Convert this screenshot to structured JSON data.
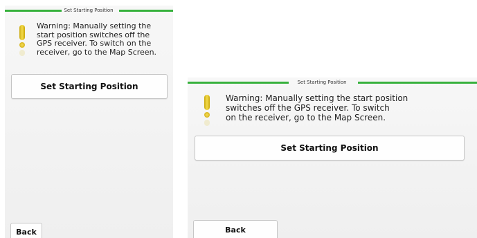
{
  "screens": [
    {
      "title": "Set Starting Position",
      "warning": "Warning: Manually setting the\nstart position switches off the\nGPS receiver. To switch on the\nreceiver, go to the Map Screen.",
      "icon": "exclamation-icon",
      "action_label": "Set Starting Position",
      "back_label": "Back"
    },
    {
      "title": "Set Starting Position",
      "warning": "Warning: Manually setting the start position\nswitches off the GPS receiver. To switch\non the receiver, go to the Map Screen.",
      "icon": "exclamation-icon",
      "action_label": "Set Starting Position",
      "back_label": "Back"
    }
  ],
  "colors": {
    "title_line": "#37b13d",
    "warning_icon": "#e4c62a",
    "background": "#f2f2f2",
    "button": "#fefefe"
  }
}
